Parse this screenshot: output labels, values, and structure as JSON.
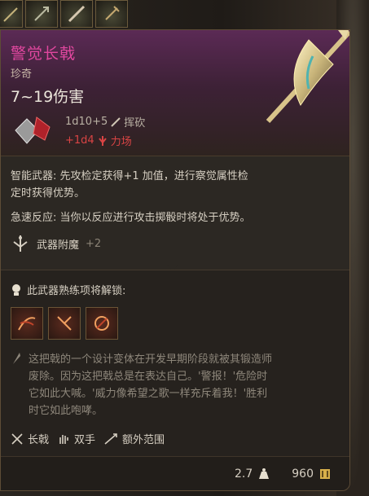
{
  "item": {
    "name": "警觉长戟",
    "rarity": "珍奇",
    "damage": "7~19伤害",
    "base_damage": "1d10+5",
    "damage_type": "挥砍",
    "bonus_damage": "+1d4",
    "bonus_type": "力场"
  },
  "properties": {
    "line1": "智能武器: 先攻检定获得+1 加值，进行察觉属性检",
    "line2": "定时获得优势。",
    "line3": "急速反应: 当你以反应进行攻击掷骰时将处于优势。",
    "enchant_label": "武器附魔",
    "enchant_value": "+2"
  },
  "proficiency": {
    "header": "此武器熟练项将解锁:",
    "actions": [
      "action-1",
      "action-2",
      "action-3"
    ]
  },
  "lore": {
    "line1": "这把戟的一个设计变体在开发早期阶段就被其锻造师",
    "line2": "废除。因为这把戟总是在表达自己。'警报！'危险时",
    "line3": "它如此大喊。'威力像希望之歌一样充斥着我！'胜利",
    "line4": "时它如此咆哮。"
  },
  "tags": {
    "weapon_type": "长戟",
    "handed": "双手",
    "reach": "额外范围"
  },
  "footer": {
    "weight": "2.7",
    "value": "960"
  },
  "colors": {
    "title": "#e0479f",
    "bonus": "#d94444"
  }
}
